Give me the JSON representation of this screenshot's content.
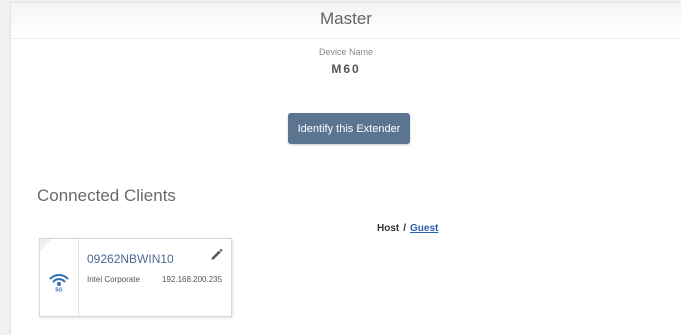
{
  "header": {
    "title": "Master"
  },
  "device": {
    "name_label": "Device Name",
    "name_value": "M60"
  },
  "actions": {
    "identify_label": "Identify this Extender"
  },
  "clients": {
    "section_title": "Connected Clients",
    "filter": {
      "host_label": "Host",
      "separator": "/",
      "guest_label": "Guest"
    },
    "items": [
      {
        "name": "09262NBWIN10",
        "vendor": "Intel Corporate",
        "ip": "192.168.200.235",
        "band": "5G",
        "icon": "wifi-5g-icon"
      }
    ]
  },
  "colors": {
    "button_bg": "#5b7490",
    "link": "#2e5ea8",
    "client_name": "#4a6a8e",
    "wifi_icon": "#2d6fb3"
  }
}
